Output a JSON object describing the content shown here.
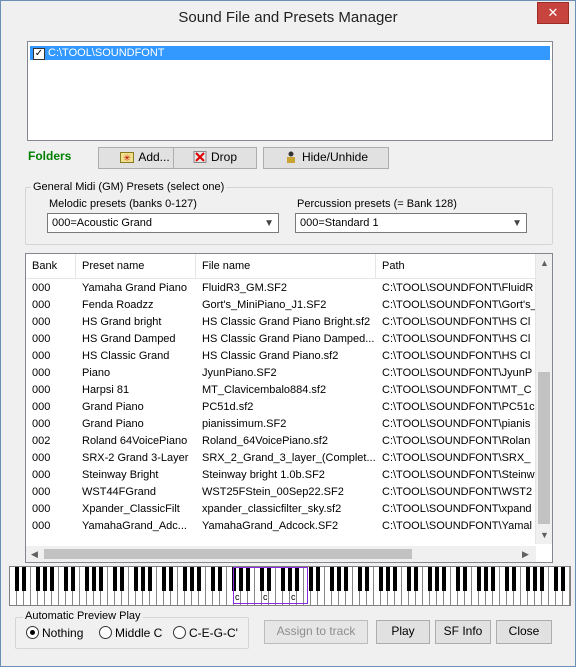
{
  "window": {
    "title": "Sound File and Presets Manager",
    "close_glyph": "✕"
  },
  "folders": {
    "items": [
      {
        "checked": true,
        "path": "C:\\TOOL\\SOUNDFONT"
      }
    ],
    "label": "Folders",
    "add_button": "Add...",
    "drop_button": "Drop",
    "hide_button": "Hide/Unhide"
  },
  "gm": {
    "group_title": "General Midi (GM) Presets (select one)",
    "melodic_label": "Melodic presets (banks 0-127)",
    "melodic_value": "000=Acoustic Grand",
    "percussion_label": "Percussion presets (= Bank 128)",
    "percussion_value": "000=Standard 1"
  },
  "table": {
    "columns": [
      "Bank",
      "Preset name",
      "File name",
      "Path"
    ],
    "rows": [
      [
        "000",
        "Yamaha Grand Piano",
        "FluidR3_GM.SF2",
        "C:\\TOOL\\SOUNDFONT\\FluidR"
      ],
      [
        "000",
        "Fenda Roadzz",
        "Gort's_MiniPiano_J1.SF2",
        "C:\\TOOL\\SOUNDFONT\\Gort's_"
      ],
      [
        "000",
        "HS Grand bright",
        "HS Classic Grand Piano Bright.sf2",
        "C:\\TOOL\\SOUNDFONT\\HS Cl"
      ],
      [
        "000",
        "HS Grand Damped",
        "HS Classic Grand Piano Damped...",
        "C:\\TOOL\\SOUNDFONT\\HS Cl"
      ],
      [
        "000",
        "HS Classic Grand",
        "HS Classic Grand Piano.sf2",
        "C:\\TOOL\\SOUNDFONT\\HS Cl"
      ],
      [
        "000",
        "Piano",
        "JyunPiano.SF2",
        "C:\\TOOL\\SOUNDFONT\\JyunP"
      ],
      [
        "000",
        "Harpsi 81",
        "MT_Clavicembalo884.sf2",
        "C:\\TOOL\\SOUNDFONT\\MT_C"
      ],
      [
        "000",
        "Grand Piano",
        "PC51d.sf2",
        "C:\\TOOL\\SOUNDFONT\\PC51c"
      ],
      [
        "000",
        "Grand Piano",
        "pianissimum.SF2",
        "C:\\TOOL\\SOUNDFONT\\pianis"
      ],
      [
        "002",
        "Roland 64VoicePiano",
        "Roland_64VoicePiano.sf2",
        "C:\\TOOL\\SOUNDFONT\\Rolan"
      ],
      [
        "000",
        "SRX-2 Grand 3-Layer",
        "SRX_2_Grand_3_layer_(Complet...",
        "C:\\TOOL\\SOUNDFONT\\SRX_"
      ],
      [
        "000",
        "Steinway Bright",
        "Steinway bright 1.0b.SF2",
        "C:\\TOOL\\SOUNDFONT\\Steinw"
      ],
      [
        "000",
        "WST44FGrand",
        "WST25FStein_00Sep22.SF2",
        "C:\\TOOL\\SOUNDFONT\\WST2"
      ],
      [
        "000",
        "Xpander_ClassicFilt",
        "xpander_classicfilter_sky.sf2",
        "C:\\TOOL\\SOUNDFONT\\xpand"
      ],
      [
        "000",
        "YamahaGrand_Adc...",
        "YamahaGrand_Adcock.SF2",
        "C:\\TOOL\\SOUNDFONT\\Yamal"
      ]
    ]
  },
  "piano": {
    "octave_marks": [
      "c",
      "c",
      "c"
    ]
  },
  "preview": {
    "group_title": "Automatic Preview Play",
    "options": [
      {
        "label": "Nothing",
        "selected": true
      },
      {
        "label": "Middle C",
        "selected": false
      },
      {
        "label": "C-E-G-C'",
        "selected": false
      }
    ]
  },
  "actions": {
    "assign": "Assign to track",
    "play": "Play",
    "sfinfo": "SF Info",
    "close": "Close"
  },
  "colors": {
    "selection": "#3399ff",
    "folders_label": "#008000",
    "octave_highlight": "#8a2be2"
  }
}
